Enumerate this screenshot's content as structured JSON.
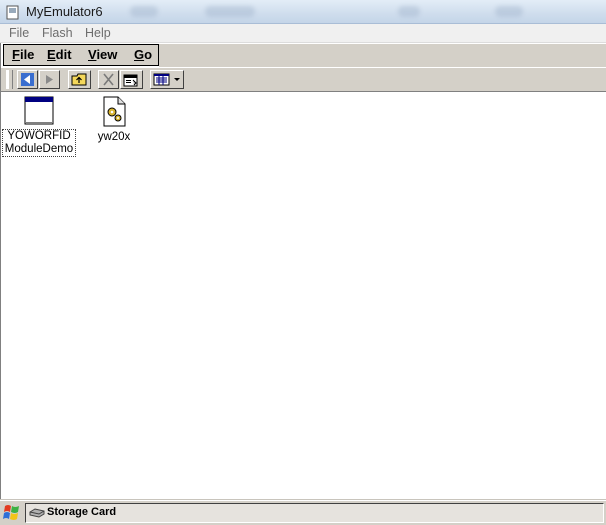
{
  "window": {
    "title": "MyEmulator6"
  },
  "host_menu": {
    "items": [
      "File",
      "Flash",
      "Help"
    ]
  },
  "device_menu": {
    "items": [
      "File",
      "Edit",
      "View",
      "Go"
    ]
  },
  "toolbar": {
    "buttons": [
      "back-icon",
      "forward-icon",
      "up-folder-icon",
      "delete-icon",
      "properties-icon",
      "view-menu-icon"
    ]
  },
  "files": [
    {
      "label_line1": "YOWORFID",
      "label_line2": "ModuleDemo",
      "icon": "application-window-icon",
      "selected": true
    },
    {
      "label_line1": "yw20x",
      "label_line2": "",
      "icon": "gear-document-icon",
      "selected": false
    }
  ],
  "taskbar": {
    "task_label": "Storage Card"
  },
  "colors": {
    "chrome": "#d4d0c8",
    "title_bar": "#dbe6f3",
    "file_window_blue": "#000080"
  }
}
